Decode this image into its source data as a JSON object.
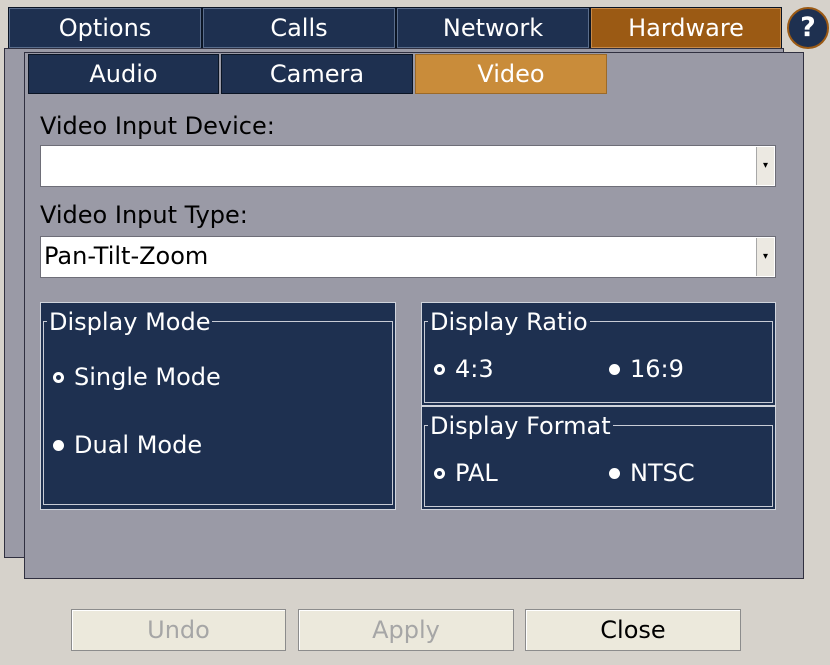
{
  "top_tabs": {
    "options": "Options",
    "calls": "Calls",
    "network": "Network",
    "hardware": "Hardware"
  },
  "help": {
    "label": "?"
  },
  "sub_tabs": {
    "audio": "Audio",
    "camera": "Camera",
    "video": "Video"
  },
  "video_input_device": {
    "label": "Video Input Device:",
    "value": ""
  },
  "video_input_type": {
    "label": "Video Input Type:",
    "value": "Pan-Tilt-Zoom"
  },
  "display_mode": {
    "legend": "Display Mode",
    "single": "Single Mode",
    "dual": "Dual Mode",
    "selected": "single"
  },
  "display_ratio": {
    "legend": "Display Ratio",
    "r43": "4:3",
    "r169": "16:9",
    "selected": "4:3"
  },
  "display_format": {
    "legend": "Display Format",
    "pal": "PAL",
    "ntsc": "NTSC",
    "selected": "PAL"
  },
  "buttons": {
    "undo": "Undo",
    "apply": "Apply",
    "close": "Close"
  },
  "colors": {
    "navy": "#1e3050",
    "active_tab": "#9b5a14",
    "active_subtab": "#c98c3a",
    "panel": "#9a9aa6",
    "background": "#d6d2cb"
  }
}
